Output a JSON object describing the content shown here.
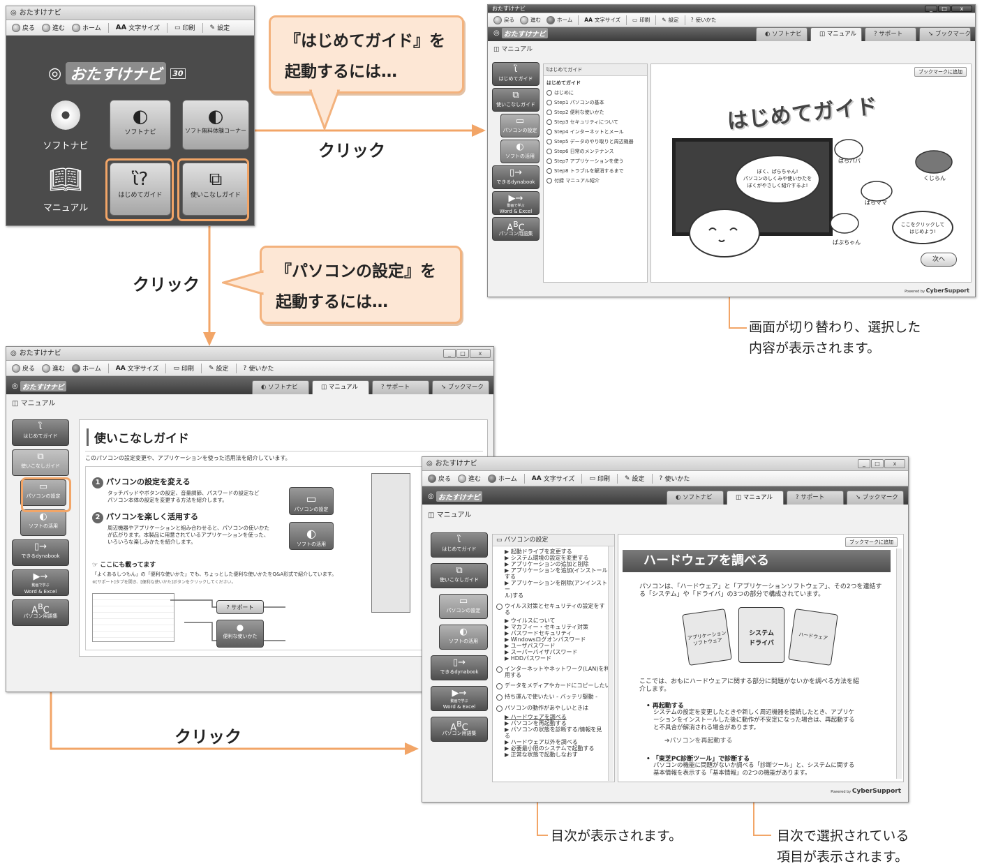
{
  "app": {
    "title": "おたすけナビ",
    "brand": "おたすけナビ",
    "brand_badge": "30"
  },
  "toolbar": {
    "back": "戻る",
    "forward": "進む",
    "home": "ホーム",
    "font_size": "文字サイズ",
    "print": "印刷",
    "settings": "設定",
    "help": "使いかた"
  },
  "tabs": [
    "ソフトナビ",
    "マニュアル",
    "サポート",
    "ブックマーク"
  ],
  "breadcrumb": "マニュアル",
  "nav": {
    "hajimete": "はじめてガイド",
    "tsukaikonashi": "使いこなしガイド",
    "pc_settei": "パソコンの設定",
    "soft_katsuyou": "ソフトの活用",
    "dekiru": "できるdynabook",
    "douga_line1": "動画で学ぶ",
    "douga_line2": "Word & Excel",
    "yougo": "パソコン用語集"
  },
  "home_menu": {
    "soft_navi": "ソフトナビ",
    "manual": "マニュアル",
    "tile_soft": "ソフトナビ",
    "tile_free": "ソフト無料体験コーナー",
    "tile_hajimete": "はじめてガイド",
    "tile_tsukai": "使いこなしガイド"
  },
  "callouts": {
    "c1_line1": "『はじめてガイド』を",
    "c1_line2": "起動するには…",
    "c2_line1": "『パソコンの設定』を",
    "c2_line2": "起動するには…"
  },
  "click_label": "クリック",
  "notes": {
    "n1": "画面が切り替わり、選択した\n内容が表示されます。",
    "n2": "目次が表示されます。",
    "n3": "目次で選択されている\n項目が表示されます。"
  },
  "hajimete_window": {
    "toc_header": "はじめてガイド",
    "toc_title": "はじめてガイド",
    "toc_items": [
      "はじめに",
      "Step1 パソコンの基本",
      "Step2 便利な使いかた",
      "Step3 セキュリティについて",
      "Step4 インターネットとメール",
      "Step5 データのやり取りと周辺機器",
      "Step6 日常のメンテナンス",
      "Step7 アプリケーションを使う",
      "Step8 トラブルを解消するまで",
      "付録 マニュアル紹介"
    ],
    "bookmark_btn": "ブックマークに追加",
    "hero": "はじめてガイド",
    "speech": "ぼく、ぱらちゃん!\nパソコンのしくみや使いかたを\nぼくがやさしく紹介するよ!",
    "char1": "ぱらパパ",
    "char2": "くじらん",
    "char3": "ぱらママ",
    "char4": "ぱぶちゃん",
    "start_tip": "ここをクリックして\nはじめよう!",
    "next_btn": "次へ",
    "powered": "CyberSupport"
  },
  "tsukai_window": {
    "heading": "使いこなしガイド",
    "intro": "このパソコンの設定変更や、アプリケーションを使った活用法を紹介しています。",
    "s1_title": "パソコンの設定を変える",
    "s1_text": "タッチパッドやボタンの設定、音量調節、パスワードの設定など\nパソコン本体の設定を変更する方法を紹介します。",
    "s2_title": "パソコンを楽しく活用する",
    "s2_text": "周辺機器やアプリケーションと組み合わせると、パソコンの使いかた\nが広がります。本製品に用意されているアプリケーションを使った、\nいろいろな楽しみかたを紹介します。",
    "also_title": "ここにも載ってます",
    "also_text": "「よくあるしつもん」の「便利な使いかた」でも、ちょっとした便利な使いかたをQ&A形式で紹介しています。",
    "also_sub": "※[サポート]タブを開き、[便利な使いかた]ボタンをクリックしてください。",
    "btn_pc": "パソコンの設定",
    "btn_soft": "ソフトの活用",
    "btn_support": "サポート",
    "btn_benri": "便利な使いかた"
  },
  "pc_window": {
    "toc_header": "パソコンの設定",
    "toc": [
      {
        "type": "sub",
        "text": "▶ 起動ドライブを変更する"
      },
      {
        "type": "sub",
        "text": "▶ システム環境の設定を変更する"
      },
      {
        "type": "sub",
        "text": "▶ アプリケーションの追加と削除"
      },
      {
        "type": "sub",
        "text": "▶ アプリケーションを追加(インストール)\nする"
      },
      {
        "type": "sub",
        "text": "▶ アプリケーションを削除(アンインストー\nル)する"
      },
      {
        "type": "group",
        "text": "ウイルス対策とセキュリティの設定をす\nる"
      },
      {
        "type": "sub",
        "text": "▶ ウイルスについて"
      },
      {
        "type": "sub",
        "text": "▶ マカフィー・セキュリティ対策"
      },
      {
        "type": "sub",
        "text": "▶ パスワードセキュリティ"
      },
      {
        "type": "sub",
        "text": "▶ Windowsログオンパスワード"
      },
      {
        "type": "sub",
        "text": "▶ ユーザパスワード"
      },
      {
        "type": "sub",
        "text": "▶ スーパーバイザパスワード"
      },
      {
        "type": "sub",
        "text": "▶ HDDパスワード"
      },
      {
        "type": "group",
        "text": "インターネットやネットワーク(LAN)を利\n用する"
      },
      {
        "type": "group",
        "text": "データをメディアやカードにコピーしたい"
      },
      {
        "type": "group",
        "text": "持ち運んで使いたい - バッテリ駆動 -"
      },
      {
        "type": "group",
        "text": "パソコンの動作があやしいときは"
      },
      {
        "type": "sub_hl",
        "text": "▶ ハードウェアを調べる"
      },
      {
        "type": "sub",
        "text": "▶ パソコンを再起動する"
      },
      {
        "type": "sub",
        "text": "▶ パソコンの状態を診断する/情報を見\nる"
      },
      {
        "type": "sub",
        "text": "▶ ハードウェア以外を調べる"
      },
      {
        "type": "sub",
        "text": "▶ 必要最小限のシステムで起動する"
      },
      {
        "type": "sub",
        "text": "▶ 正常な状態で起動しなおす"
      }
    ],
    "bookmark_btn": "ブックマークに追加",
    "heading": "ハードウェアを調べる",
    "p1": "パソコンは、「ハードウェア」と「アプリケーションソフトウェア」、その2つを連結す\nる「システム」や「ドライバ」の3つの部分で構成されています。",
    "card_app": "アプリケーション\nソフトウェア",
    "card_sys": "システム\nドライバ",
    "card_hw": "ハードウェア",
    "p2": "ここでは、おもにハードウェアに関する部分に問題がないかを調べる方法を紹\n介します。",
    "b1_title": "再起動する",
    "b1_text": "システムの設定を変更したときや新しく周辺機器を接続したとき、アプリケ\nーションをインストールした後に動作が不安定になった場合は、再起動する\nと不具合が解消される場合があります。",
    "b1_link": "パソコンを再起動する",
    "b2_title": "「東芝PC診断ツール」で診断する",
    "b2_text": "パソコンの機能に問題がないか調べる「診断ツール」と、システムに関する\n基本情報を表示する「基本情報」の2つの機能があります。",
    "powered": "CyberSupport"
  },
  "colors": {
    "accent": "#f2a567",
    "callout_bg": "#fde7d5",
    "dark_bar": "#3b3b3b"
  }
}
